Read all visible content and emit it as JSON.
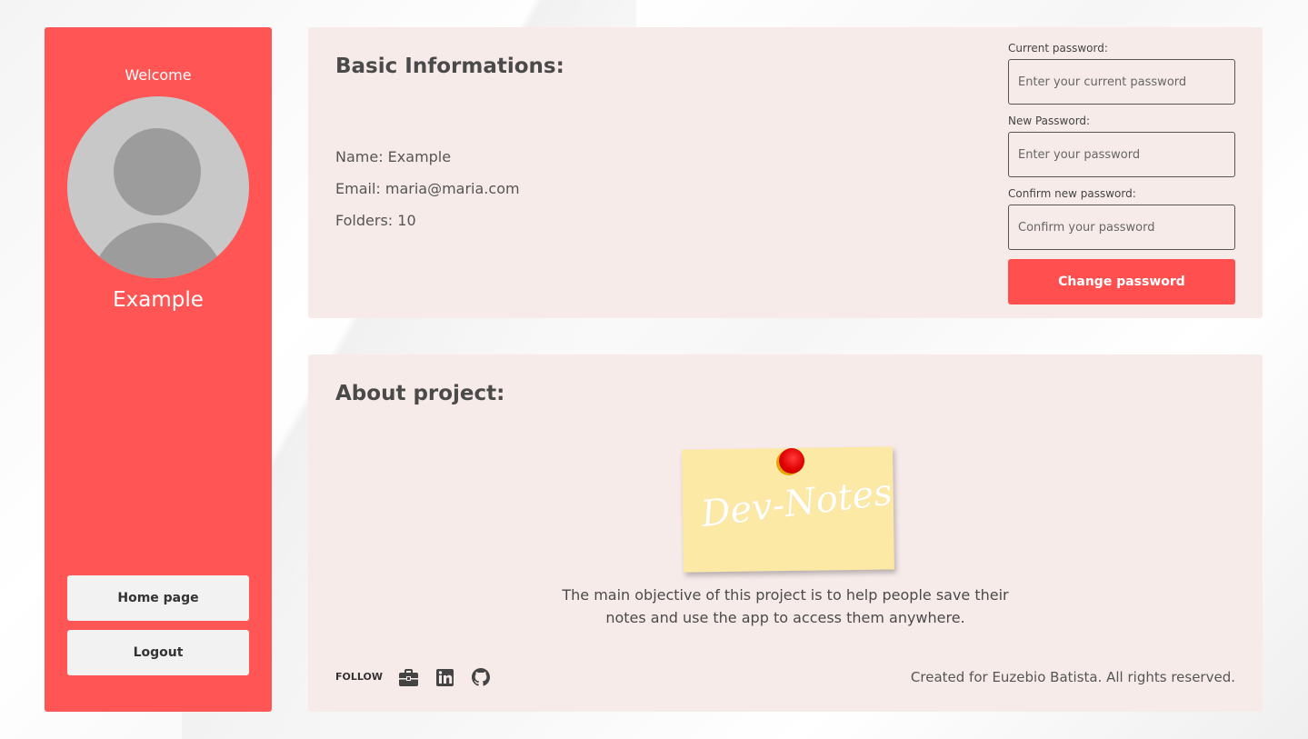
{
  "sidebar": {
    "welcome": "Welcome",
    "username": "Example",
    "home_button": "Home page",
    "logout_button": "Logout"
  },
  "info": {
    "title": "Basic Informations:",
    "name_line": "Name: Example",
    "email_line": "Email: maria@maria.com",
    "folders_line": "Folders: 10"
  },
  "password_form": {
    "current_label": "Current password:",
    "current_placeholder": "Enter your current password",
    "new_label": "New Password:",
    "new_placeholder": "Enter your password",
    "confirm_label": "Confirm new password:",
    "confirm_placeholder": "Confirm your password",
    "submit_label": "Change password"
  },
  "about": {
    "title": "About project:",
    "note_text": "Dev-Notes",
    "description": "The main objective of this project is to help people save their notes and use the app to access them anywhere."
  },
  "footer": {
    "follow_label": "FOLLOW",
    "social_icons": [
      "briefcase-icon",
      "linkedin-icon",
      "github-icon"
    ],
    "rights_text": "Created for Euzebio Batista. All rights reserved."
  },
  "colors": {
    "accent": "#ff5555",
    "panel_bg": "#f7ebea",
    "note_bg": "#fde9a6"
  }
}
